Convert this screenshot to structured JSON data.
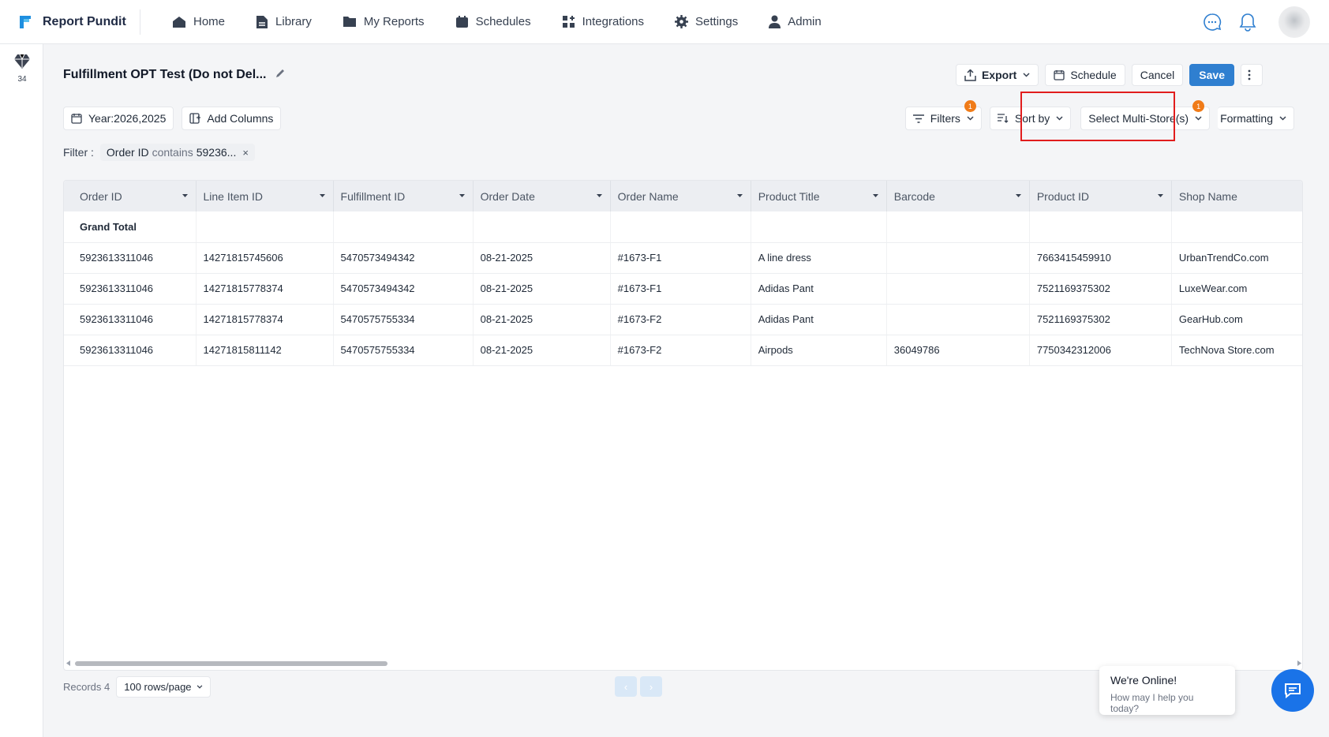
{
  "brand": {
    "name": "Report Pundit"
  },
  "nav": {
    "items": [
      {
        "label": "Home",
        "icon": "home-icon"
      },
      {
        "label": "Library",
        "icon": "file-icon"
      },
      {
        "label": "My Reports",
        "icon": "folder-icon"
      },
      {
        "label": "Schedules",
        "icon": "calendar-icon"
      },
      {
        "label": "Integrations",
        "icon": "apps-icon"
      },
      {
        "label": "Settings",
        "icon": "gear-icon"
      },
      {
        "label": "Admin",
        "icon": "user-icon"
      }
    ]
  },
  "rail": {
    "count": "34"
  },
  "report": {
    "title": "Fulfillment OPT Test (Do not Del...",
    "actions": {
      "export": "Export",
      "schedule": "Schedule",
      "cancel": "Cancel",
      "save": "Save"
    }
  },
  "toolbar": {
    "year": "Year:2026,2025",
    "add_columns": "Add Columns",
    "filters": "Filters",
    "filters_badge": "1",
    "sort_by": "Sort by",
    "multistore": "Select Multi-Store(s)",
    "multistore_badge": "1",
    "formatting": "Formatting"
  },
  "filter": {
    "label": "Filter :",
    "field": "Order ID",
    "operator": "contains",
    "value": "59236...",
    "remove": "×"
  },
  "table": {
    "columns": [
      "Order ID",
      "Line Item ID",
      "Fulfillment ID",
      "Order Date",
      "Order Name",
      "Product Title",
      "Barcode",
      "Product ID",
      "Shop Name"
    ],
    "grand_total": "Grand Total",
    "rows": [
      [
        "5923613311046",
        "14271815745606",
        "5470573494342",
        "08-21-2025",
        "#1673-F1",
        "A line dress",
        "",
        "7663415459910",
        "UrbanTrendCo.com"
      ],
      [
        "5923613311046",
        "14271815778374",
        "5470573494342",
        "08-21-2025",
        "#1673-F1",
        "Adidas Pant",
        "",
        "7521169375302",
        "LuxeWear.com"
      ],
      [
        "5923613311046",
        "14271815778374",
        "5470575755334",
        "08-21-2025",
        "#1673-F2",
        "Adidas Pant",
        "",
        "7521169375302",
        "GearHub.com"
      ],
      [
        "5923613311046",
        "14271815811142",
        "5470575755334",
        "08-21-2025",
        "#1673-F2",
        "Airpods",
        "36049786",
        "7750342312006",
        "TechNova Store.com"
      ]
    ]
  },
  "footer": {
    "records": "Records 4",
    "rows_per_page": "100 rows/page"
  },
  "pager": {
    "prev": "‹",
    "next": "›"
  },
  "chat": {
    "title": "We're Online!",
    "subtitle": "How may I help you today?"
  },
  "colors": {
    "primary": "#2f7fd0",
    "badge": "#f07b18",
    "highlight": "#e11d1d",
    "chat": "#1a73e8"
  }
}
